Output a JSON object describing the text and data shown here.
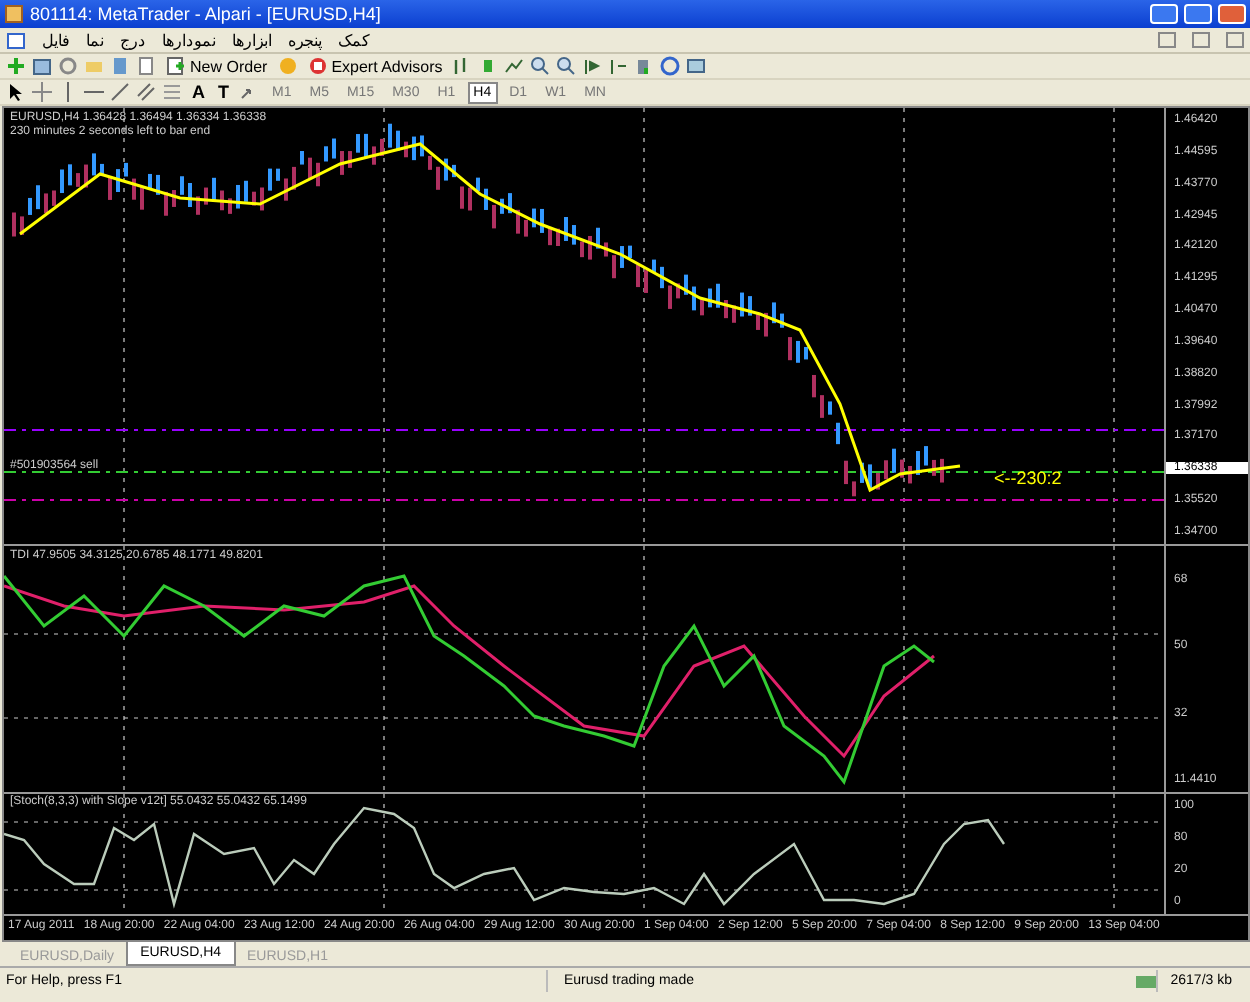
{
  "window": {
    "title": "801114: MetaTrader - Alpari - [EURUSD,H4]"
  },
  "menu": [
    "کمک",
    "پنجره",
    "ابزارها",
    "نمودارها",
    "درج",
    "نما",
    "فایل"
  ],
  "toolbar": {
    "buttons": [
      "New Order",
      "Expert Advisors"
    ]
  },
  "drawing_toolbar": {
    "text_tools": [
      "A",
      "T"
    ]
  },
  "timeframes": [
    {
      "label": "M1",
      "selected": false
    },
    {
      "label": "M5",
      "selected": false
    },
    {
      "label": "M15",
      "selected": false
    },
    {
      "label": "M30",
      "selected": false
    },
    {
      "label": "H1",
      "selected": false
    },
    {
      "label": "H4",
      "selected": true
    },
    {
      "label": "D1",
      "selected": false
    },
    {
      "label": "W1",
      "selected": false
    },
    {
      "label": "MN",
      "selected": false
    }
  ],
  "chart": {
    "header": "EURUSD,H4  1.36428 1.36494 1.36334 1.36338",
    "countdown": "230 minutes 2 seconds left to bar end",
    "order_label": "#501903564 sell",
    "price_marker": "<--230:2",
    "price_axis": [
      {
        "label": "1.46420",
        "current": false
      },
      {
        "label": "1.44595",
        "current": false
      },
      {
        "label": "1.43770",
        "current": false
      },
      {
        "label": "1.42945",
        "current": false
      },
      {
        "label": "1.42120",
        "current": false
      },
      {
        "label": "1.41295",
        "current": false
      },
      {
        "label": "1.40470",
        "current": false
      },
      {
        "label": "1.39640",
        "current": false
      },
      {
        "label": "1.38820",
        "current": false
      },
      {
        "label": "1.37992",
        "current": false
      },
      {
        "label": "1.37170",
        "current": false
      },
      {
        "label": "1.36338",
        "current": true
      },
      {
        "label": "1.35520",
        "current": false
      },
      {
        "label": "1.34700",
        "current": false
      }
    ]
  },
  "tdi": {
    "header": "TDI 47.9505 34.3125 20.6785 48.1771 49.8201",
    "axis": [
      "68",
      "50",
      "32",
      "11.4410"
    ]
  },
  "stochastic": {
    "header": "[Stoch(8,3,3) with Slope v12t] 55.0432 55.0432 65.1499",
    "axis": [
      "100",
      "80",
      "20",
      "0"
    ]
  },
  "time_axis": [
    "17 Aug 2011",
    "18 Aug 20:00",
    "22 Aug 04:00",
    "23 Aug 12:00",
    "24 Aug 20:00",
    "26 Aug 04:00",
    "29 Aug 12:00",
    "30 Aug 20:00",
    "1 Sep 04:00",
    "2 Sep 12:00",
    "5 Sep 20:00",
    "7 Sep 04:00",
    "8 Sep 12:00",
    "9 Sep 20:00",
    "13 Sep 04:00"
  ],
  "chart_tabs": [
    {
      "label": "EURUSD,Daily",
      "selected": false
    },
    {
      "label": "EURUSD,H4",
      "selected": true
    },
    {
      "label": "EURUSD,H1",
      "selected": false
    }
  ],
  "status_bar": {
    "help": "For Help, press F1",
    "message": "Eurusd trading made",
    "traffic": "2617/3 kb"
  }
}
